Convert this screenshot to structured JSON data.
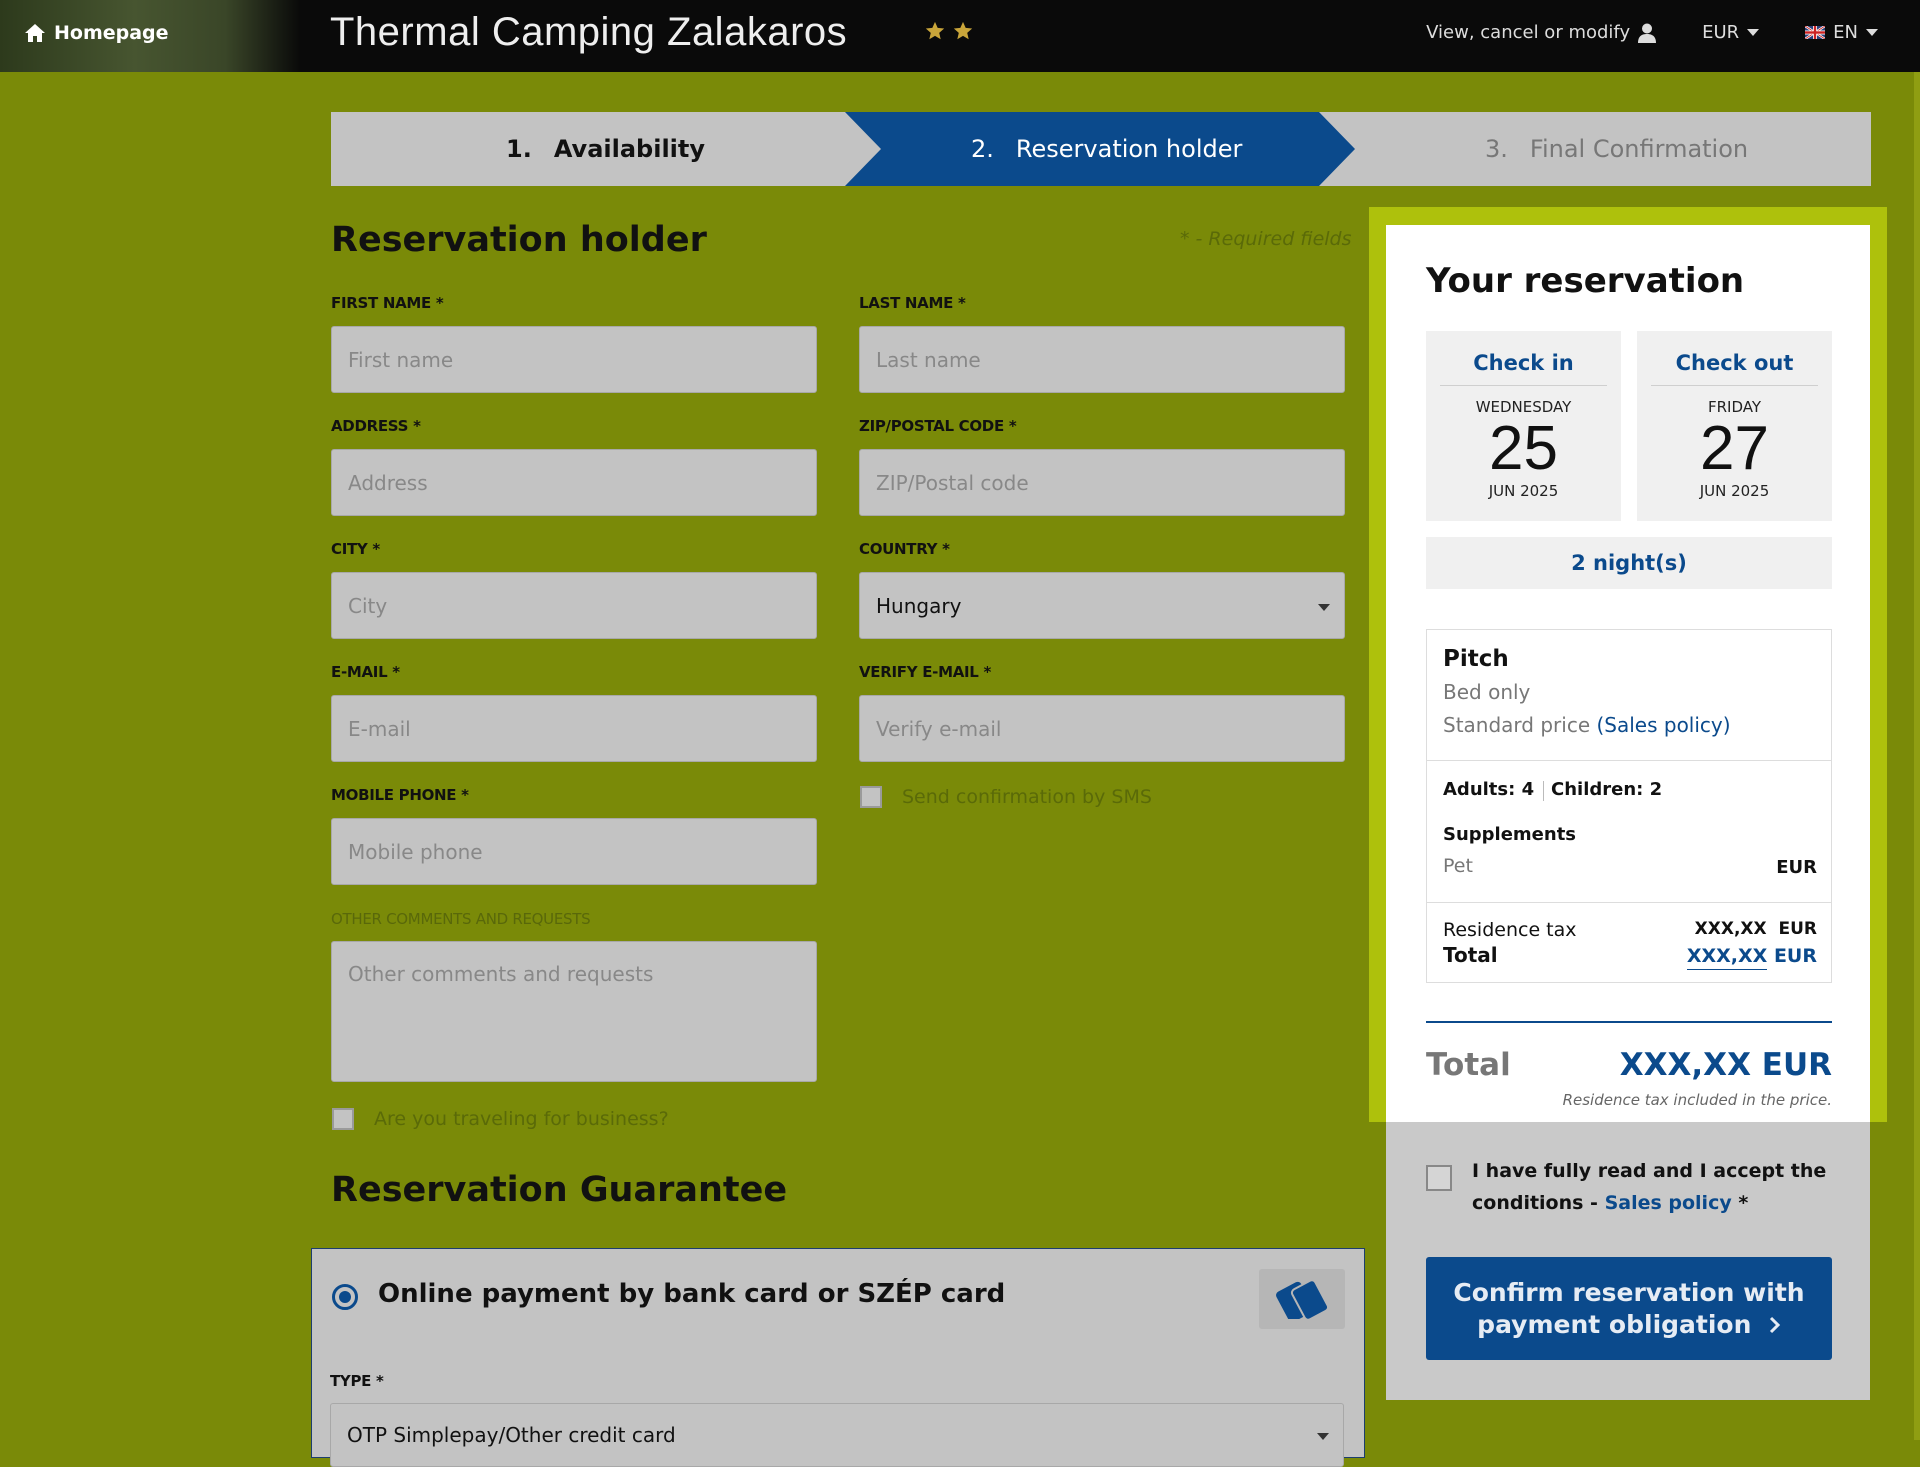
{
  "header": {
    "home_label": "Homepage",
    "site_title": "Thermal Camping Zalakaros",
    "stars": 2,
    "manage_label": "View, cancel or modify",
    "currency": "EUR",
    "language": "EN"
  },
  "steps": [
    {
      "num": "1.",
      "label": "Availability"
    },
    {
      "num": "2.",
      "label": "Reservation holder"
    },
    {
      "num": "3.",
      "label": "Final Confirmation"
    }
  ],
  "form": {
    "title": "Reservation holder",
    "required_note": "* - Required fields",
    "first_name": {
      "label": "FIRST NAME *",
      "placeholder": "First name"
    },
    "last_name": {
      "label": "LAST NAME *",
      "placeholder": "Last name"
    },
    "address": {
      "label": "ADDRESS *",
      "placeholder": "Address"
    },
    "zip": {
      "label": "ZIP/POSTAL CODE *",
      "placeholder": "ZIP/Postal code"
    },
    "city": {
      "label": "CITY *",
      "placeholder": "City"
    },
    "country": {
      "label": "COUNTRY *",
      "value": "Hungary"
    },
    "email": {
      "label": "E-MAIL *",
      "placeholder": "E-mail"
    },
    "verify_email": {
      "label": "VERIFY E-MAIL *",
      "placeholder": "Verify e-mail"
    },
    "sms_label": "Send confirmation by SMS",
    "mobile": {
      "label": "MOBILE PHONE *",
      "placeholder": "Mobile phone"
    },
    "comments": {
      "label": "OTHER COMMENTS AND REQUESTS",
      "placeholder": "Other comments and requests"
    },
    "business_label": "Are you traveling for business?"
  },
  "guarantee": {
    "title": "Reservation Guarantee",
    "option_label": "Online payment by bank card or SZÉP card",
    "type_label": "TYPE *",
    "type_value": "OTP Simplepay/Other credit card"
  },
  "summary": {
    "title": "Your reservation",
    "check_in": {
      "label": "Check in",
      "weekday": "WEDNESDAY",
      "day": "25",
      "month_year": "JUN 2025"
    },
    "check_out": {
      "label": "Check out",
      "weekday": "FRIDAY",
      "day": "27",
      "month_year": "JUN 2025"
    },
    "nights": "2 night(s)",
    "pitch": "Pitch",
    "bed": "Bed only",
    "price_type": "Standard price",
    "sales_policy": "(Sales policy)",
    "adults": "Adults: 4",
    "children": "Children: 2",
    "supplements_label": "Supplements",
    "pet_label": "Pet",
    "pet_currency": "EUR",
    "residence_tax_label": "Residence tax",
    "residence_tax_value": "XXX,XX",
    "residence_tax_currency": "EUR",
    "subtotal_label": "Total",
    "subtotal_value": "XXX,XX",
    "subtotal_currency": "EUR",
    "total_label": "Total",
    "total_value": "XXX,XX EUR",
    "tax_note": "Residence tax included in the price.",
    "accept_text": "I have fully read and I accept the conditions - ",
    "accept_link": "Sales policy",
    "accept_suffix": " *",
    "confirm_button": "Confirm reservation with payment obligation"
  },
  "colors": {
    "page_background": "#7a8a08",
    "accent_blue": "#0b4a8c",
    "summary_highlight": "#aec10c"
  }
}
